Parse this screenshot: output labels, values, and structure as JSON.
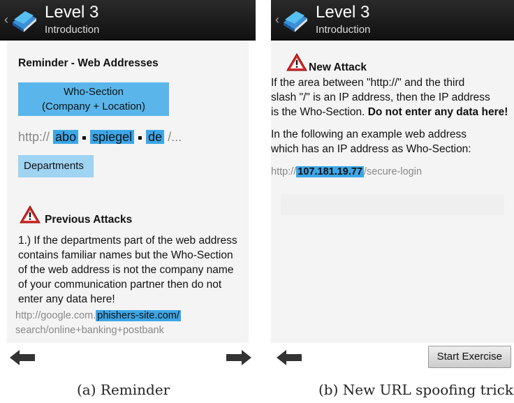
{
  "left": {
    "header": {
      "title": "Level 3",
      "subtitle": "Introduction"
    },
    "reminder_title": "Reminder - Web Addresses",
    "who_section_label": [
      "Who-Section",
      "(Company + Location)"
    ],
    "url": {
      "prefix": "http://",
      "seg1": "abo",
      "seg2": "spiegel",
      "seg3": "de",
      "suffix": "/..."
    },
    "departments_label": "Departments",
    "attack_title": "Previous Attacks",
    "attack_text": [
      "1.) If the departments part of the web address",
      "contains familiar names but the Who-Section",
      "of the web address is not the company name",
      "of your communication partner then do not",
      "enter any data here!"
    ],
    "example_url": {
      "prefix": "http://google.com.",
      "highlight": "phishers-site.com/",
      "line2": "search/online+banking+postbank"
    }
  },
  "right": {
    "header": {
      "title": "Level 3",
      "subtitle": "Introduction"
    },
    "attack_title": "New Attack",
    "text": [
      "If the area between \"http://\" and the third",
      "slash \"/\" is an IP address, then the IP address"
    ],
    "text_line3_normal": "is the Who-Section. ",
    "text_line3_bold": "Do not enter any data here!",
    "example_intro": [
      "In the following an example web address",
      "which has an IP address as Who-Section:"
    ],
    "example_url": {
      "prefix": "http://",
      "highlight": "107.181.19.77",
      "suffix": "/secure-login"
    },
    "start_button": "Start Exercise"
  },
  "captions": {
    "left": "(a) Reminder",
    "right": "(b) New URL spoofing trick"
  }
}
